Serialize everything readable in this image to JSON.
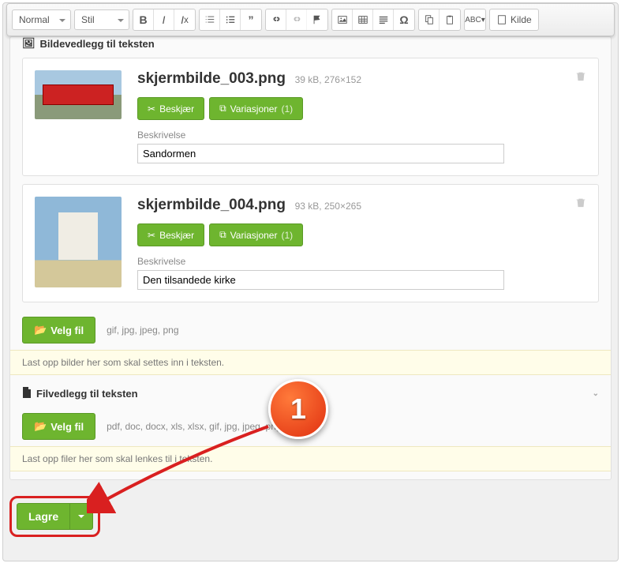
{
  "toolbar": {
    "format_label": "Normal",
    "style_label": "Stil",
    "kilde_label": "Kilde"
  },
  "section_image": {
    "title": "Bildevedlegg til teksten",
    "attachments": [
      {
        "filename": "skjermbilde_003.png",
        "meta": "39 kB, 276×152",
        "crop_label": "Beskjær",
        "variations_label": "Variasjoner",
        "variations_count": "(1)",
        "desc_label": "Beskrivelse",
        "desc_value": "Sandormen"
      },
      {
        "filename": "skjermbilde_004.png",
        "meta": "93 kB, 250×265",
        "crop_label": "Beskjær",
        "variations_label": "Variasjoner",
        "variations_count": "(1)",
        "desc_label": "Beskrivelse",
        "desc_value": "Den tilsandede kirke"
      }
    ],
    "choose_file_label": "Velg fil",
    "filetypes": "gif, jpg, jpeg, png",
    "hint": "Last opp bilder her som skal settes inn i teksten."
  },
  "section_file": {
    "title": "Filvedlegg til teksten",
    "choose_file_label": "Velg fil",
    "filetypes": "pdf, doc, docx, xls, xlsx, gif, jpg, jpeg, png, zip",
    "hint": "Last opp filer her som skal lenkes til i teksten."
  },
  "save_button_label": "Lagre",
  "annotation_number": "1"
}
